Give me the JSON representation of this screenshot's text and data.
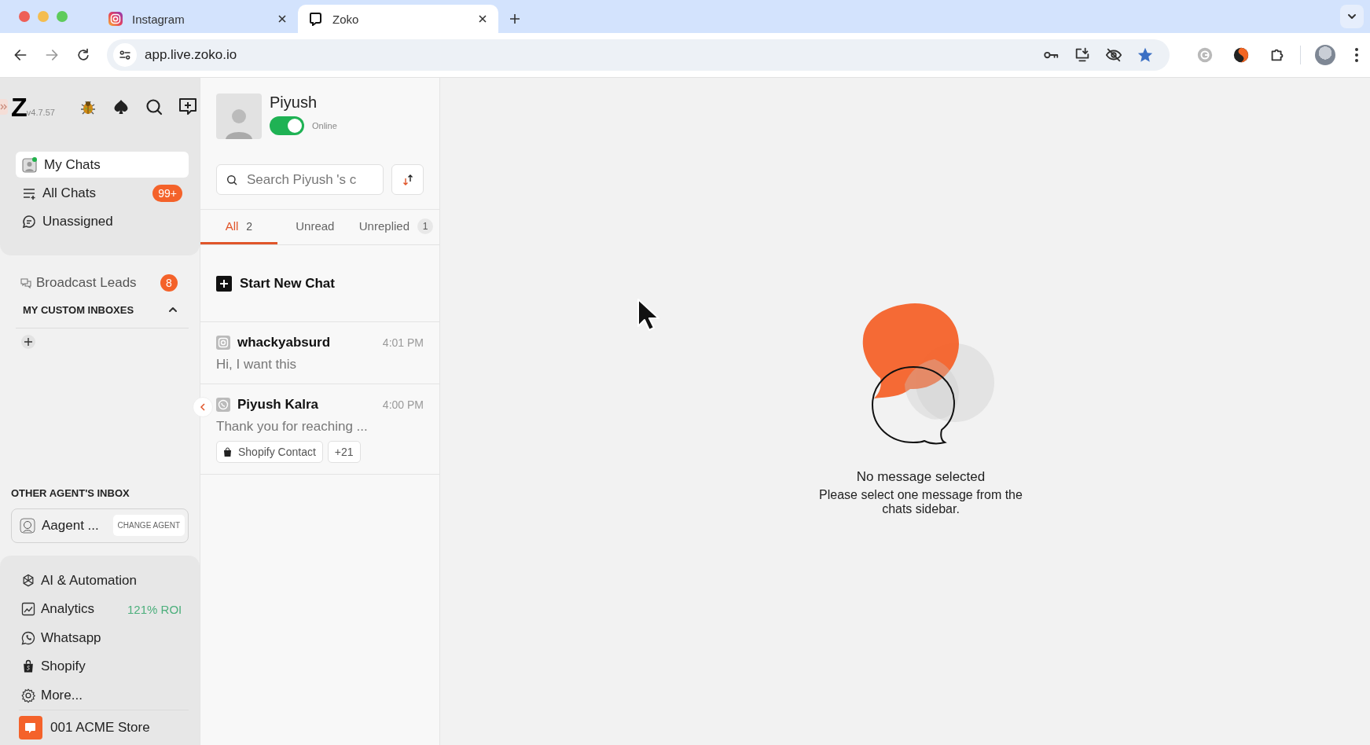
{
  "browser": {
    "tabs": [
      {
        "title": "Instagram",
        "selected": false,
        "kind": "instagram"
      },
      {
        "title": "Zoko",
        "selected": true,
        "kind": "zoko"
      }
    ],
    "url": "app.live.zoko.io"
  },
  "sidebar": {
    "logo": "Z",
    "version": "v4.7.57",
    "nav": [
      {
        "label": "My Chats",
        "selected": true
      },
      {
        "label": "All Chats",
        "selected": false,
        "badge": "99+"
      },
      {
        "label": "Unassigned",
        "selected": false
      }
    ],
    "broadcast": {
      "label": "Broadcast Leads",
      "badge": "8"
    },
    "custom_inboxes": {
      "title": "MY CUSTOM INBOXES",
      "expanded": true
    },
    "other_agent": {
      "title": "OTHER AGENT'S INBOX",
      "agent": "Aagent ...",
      "button": "CHANGE AGENT"
    },
    "tools": [
      {
        "label": "AI & Automation"
      },
      {
        "label": "Analytics",
        "note": "121% ROI"
      },
      {
        "label": "Whatsapp"
      },
      {
        "label": "Shopify"
      },
      {
        "label": "More..."
      }
    ],
    "store": "001 ACME Store"
  },
  "chat_panel": {
    "profile": {
      "name": "Piyush",
      "online": true,
      "status": "Online"
    },
    "search": {
      "placeholder": "Search Piyush 's c"
    },
    "tabs": [
      {
        "label": "All",
        "count": "2",
        "selected": true
      },
      {
        "label": "Unread",
        "selected": false
      },
      {
        "label": "Unreplied",
        "count": "1",
        "selected": false
      }
    ],
    "start_new_chat": "Start New Chat",
    "chats": [
      {
        "name": "whackyabsurd",
        "kind": "instagram",
        "time": "4:01 PM",
        "preview": "Hi, I want this"
      },
      {
        "name": "Piyush Kalra",
        "kind": "whatsapp",
        "time": "4:00 PM",
        "preview": "Thank you for reaching ...",
        "tags": [
          "Shopify Contact",
          "+21"
        ]
      }
    ]
  },
  "main": {
    "empty_title": "No message selected",
    "empty_text": "Please select one message from the chats sidebar."
  }
}
